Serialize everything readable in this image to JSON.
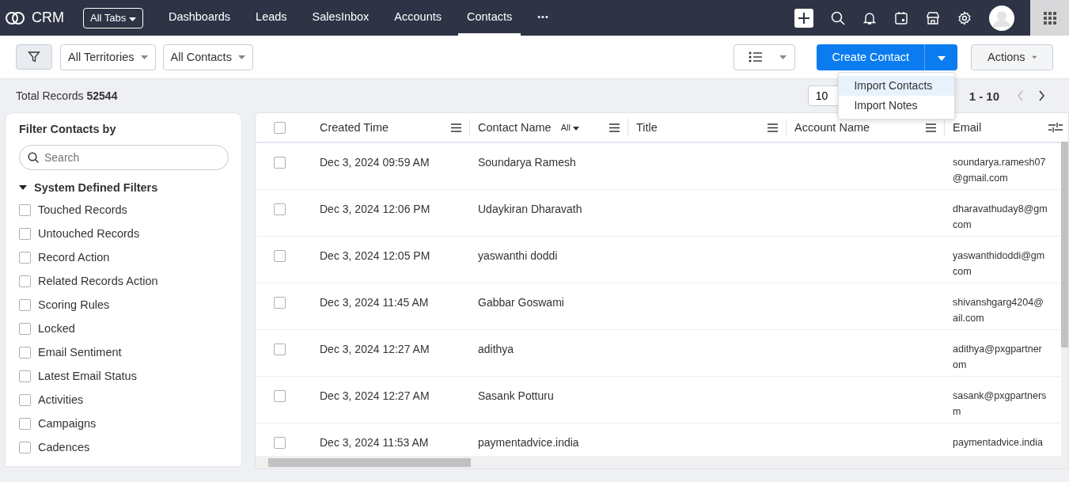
{
  "app": {
    "name": "CRM"
  },
  "nav": {
    "all_tabs": "All Tabs",
    "tabs": [
      {
        "label": "Dashboards",
        "selected": false
      },
      {
        "label": "Leads",
        "selected": false
      },
      {
        "label": "SalesInbox",
        "selected": false
      },
      {
        "label": "Accounts",
        "selected": false
      },
      {
        "label": "Contacts",
        "selected": true
      }
    ],
    "more": "•••"
  },
  "toolbar": {
    "territory": "All Territories",
    "view": "All Contacts",
    "create": "Create Contact",
    "actions": "Actions"
  },
  "create_menu": {
    "items": [
      {
        "label": "Import Contacts",
        "selected": true
      },
      {
        "label": "Import Notes",
        "selected": false
      }
    ]
  },
  "summary": {
    "label": "Total Records",
    "count": "52544",
    "per_page": "10",
    "range": "1 - 10"
  },
  "filters": {
    "title": "Filter Contacts by",
    "search": {
      "placeholder": "Search"
    },
    "group": {
      "label": "System Defined Filters",
      "expanded": true
    },
    "items": [
      {
        "label": "Touched Records",
        "checked": false
      },
      {
        "label": "Untouched Records",
        "checked": false
      },
      {
        "label": "Record Action",
        "checked": false
      },
      {
        "label": "Related Records Action",
        "checked": false
      },
      {
        "label": "Scoring Rules",
        "checked": false
      },
      {
        "label": "Locked",
        "checked": false
      },
      {
        "label": "Email Sentiment",
        "checked": false
      },
      {
        "label": "Latest Email Status",
        "checked": false
      },
      {
        "label": "Activities",
        "checked": false
      },
      {
        "label": "Campaigns",
        "checked": false
      },
      {
        "label": "Cadences",
        "checked": false
      }
    ]
  },
  "table": {
    "select_all": {
      "checked": false
    },
    "columns": [
      {
        "label": "Created Time"
      },
      {
        "label": "Contact Name",
        "filter": "All"
      },
      {
        "label": "Title"
      },
      {
        "label": "Account Name"
      },
      {
        "label": "Email"
      }
    ],
    "rows": [
      {
        "checked": false,
        "created": "Dec 3, 2024 09:59 AM",
        "name": "Soundarya Ramesh",
        "email": "soundarya.ramesh07\n@gmail.com"
      },
      {
        "checked": false,
        "created": "Dec 3, 2024 12:06 PM",
        "name": "Udaykiran Dharavath",
        "email": "dharavathuday8@gm\ncom"
      },
      {
        "checked": false,
        "created": "Dec 3, 2024 12:05 PM",
        "name": "yaswanthi doddi",
        "email": "yaswanthidoddi@gm\ncom"
      },
      {
        "checked": false,
        "created": "Dec 3, 2024 11:45 AM",
        "name": "Gabbar Goswami",
        "email": "shivanshgarg4204@\nail.com"
      },
      {
        "checked": false,
        "created": "Dec 3, 2024 12:27 AM",
        "name": "adithya",
        "email": "adithya@pxgpartner\nom"
      },
      {
        "checked": false,
        "created": "Dec 3, 2024 12:27 AM",
        "name": "Sasank Potturu",
        "email": "sasank@pxgpartners\nm"
      },
      {
        "checked": false,
        "created": "Dec 3, 2024 11:53 AM",
        "name": "paymentadvice.india",
        "email": "paymentadvice.india"
      }
    ]
  }
}
